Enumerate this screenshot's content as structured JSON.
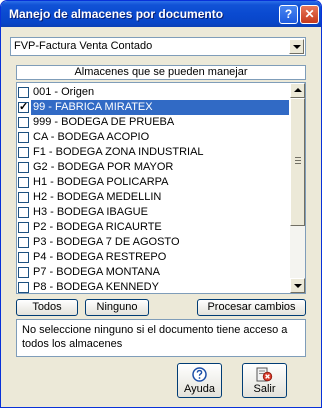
{
  "window": {
    "title": "Manejo de almacenes por documento",
    "help_title_btn": "?",
    "close_title_btn": "✕"
  },
  "document_select": {
    "selected": "FVP-Factura Venta Contado"
  },
  "warehouses": {
    "header": "Almacenes que se pueden manejar",
    "items": [
      {
        "label": "001 - Origen",
        "checked": false,
        "selected": false
      },
      {
        "label": "99 - FABRICA MIRATEX",
        "checked": true,
        "selected": true
      },
      {
        "label": "999 - BODEGA DE PRUEBA",
        "checked": false,
        "selected": false
      },
      {
        "label": "CA - BODEGA ACOPIO",
        "checked": false,
        "selected": false
      },
      {
        "label": "F1 - BODEGA ZONA INDUSTRIAL",
        "checked": false,
        "selected": false
      },
      {
        "label": "G2 - BODEGA POR MAYOR",
        "checked": false,
        "selected": false
      },
      {
        "label": "H1 - BODEGA POLICARPA",
        "checked": false,
        "selected": false
      },
      {
        "label": "H2 - BODEGA MEDELLIN",
        "checked": false,
        "selected": false
      },
      {
        "label": "H3 - BODEGA IBAGUE",
        "checked": false,
        "selected": false
      },
      {
        "label": "P2 - BODEGA RICAURTE",
        "checked": false,
        "selected": false
      },
      {
        "label": "P3 - BODEGA 7 DE AGOSTO",
        "checked": false,
        "selected": false
      },
      {
        "label": "P4 - BODEGA RESTREPO",
        "checked": false,
        "selected": false
      },
      {
        "label": "P7 - BODEGA MONTANA",
        "checked": false,
        "selected": false
      },
      {
        "label": "P8 - BODEGA KENNEDY",
        "checked": false,
        "selected": false
      }
    ]
  },
  "buttons": {
    "todos": "Todos",
    "ninguno": "Ninguno",
    "procesar": "Procesar cambios",
    "ayuda": "Ayuda",
    "salir": "Salir"
  },
  "note": "No seleccione ninguno si el documento tiene acceso a todos los almacenes",
  "icons": {
    "help": "help-icon",
    "exit": "exit-icon"
  },
  "colors": {
    "titlebar": "#0a4ad0",
    "selection": "#316ac5",
    "window_bg": "#ece9d8"
  }
}
